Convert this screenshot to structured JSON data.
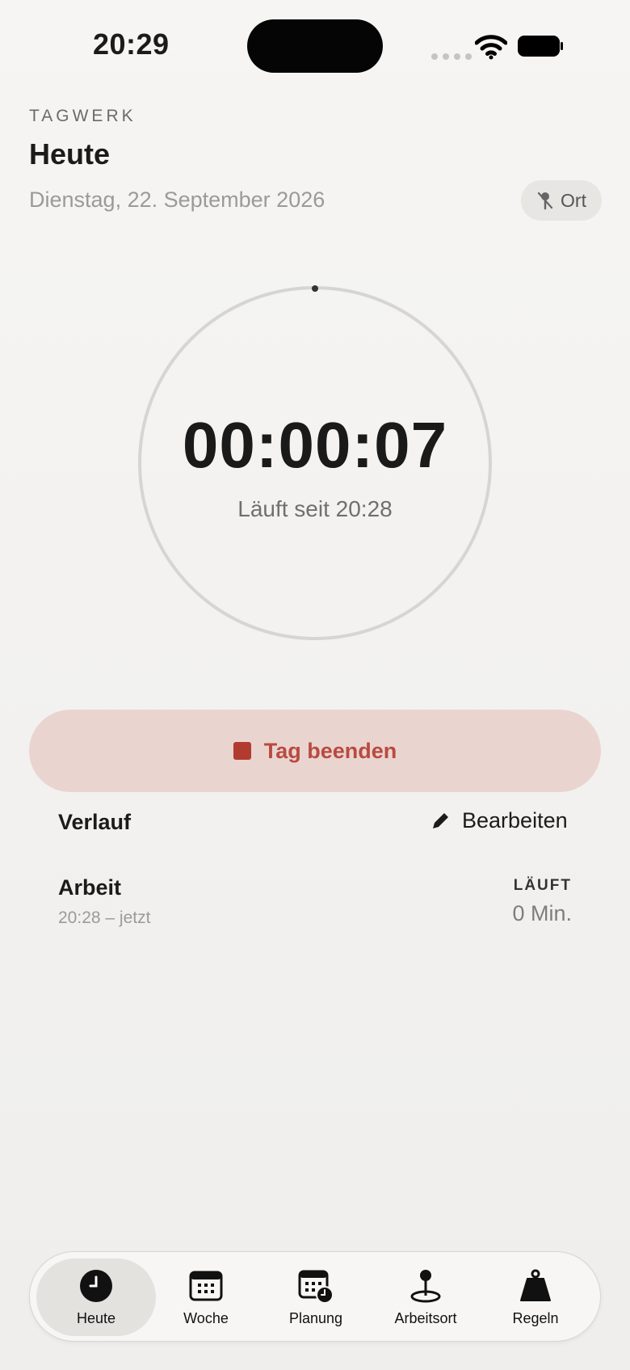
{
  "status_bar": {
    "time": "20:29"
  },
  "header": {
    "brand": "TAGWERK",
    "title": "Heute",
    "date": "Dienstag, 22. September 2026",
    "location_button": "Ort"
  },
  "timer": {
    "value": "00:00:07",
    "subtitle": "Läuft seit 20:28"
  },
  "end_button": {
    "label": "Tag beenden"
  },
  "history": {
    "title": "Verlauf",
    "edit_label": "Bearbeiten",
    "entries": [
      {
        "name": "Arbeit",
        "range": "20:28 – jetzt",
        "status": "LÄUFT",
        "duration": "0 Min."
      }
    ]
  },
  "tabs": [
    {
      "label": "Heute",
      "icon": "clock-icon",
      "active": true
    },
    {
      "label": "Woche",
      "icon": "calendar-icon",
      "active": false
    },
    {
      "label": "Planung",
      "icon": "calendar-clock-icon",
      "active": false
    },
    {
      "label": "Arbeitsort",
      "icon": "map-pin-icon",
      "active": false
    },
    {
      "label": "Regeln",
      "icon": "weight-icon",
      "active": false
    }
  ],
  "colors": {
    "accent": "#b94a3f",
    "end_button_bg": "#ead4d0",
    "background": "#f3f2f0"
  }
}
